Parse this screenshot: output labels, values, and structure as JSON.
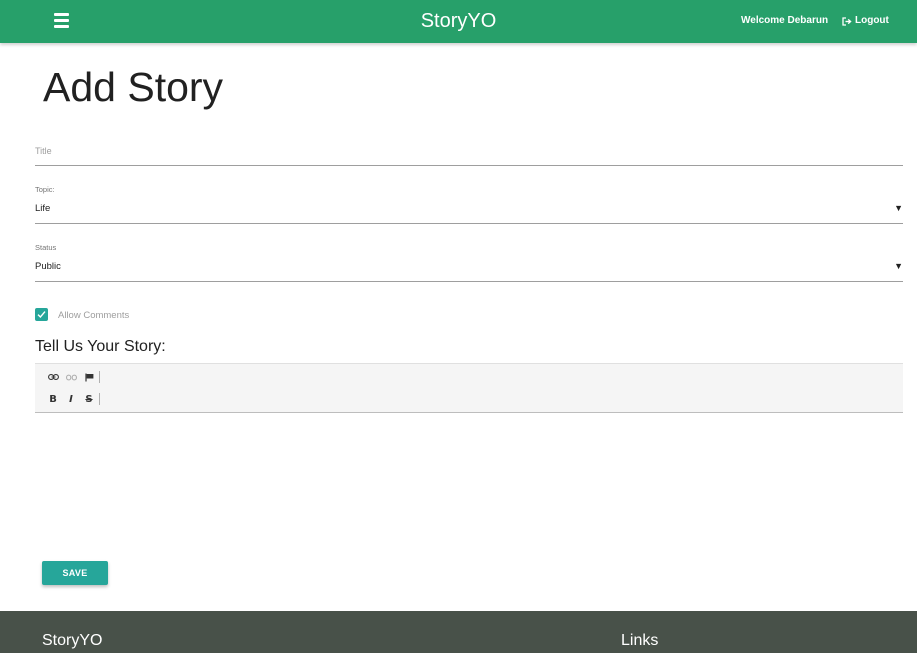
{
  "navbar": {
    "brand": "StoryYO",
    "welcome": "Welcome Debarun",
    "logout_label": "Logout",
    "menu_icon": "hamburger-menu-icon",
    "logout_icon": "sign-out-icon",
    "color": "#27a06a"
  },
  "page": {
    "title": "Add Story"
  },
  "form": {
    "title_placeholder": "Title",
    "topic": {
      "label": "Topic:",
      "value": "Life"
    },
    "status": {
      "label": "Status",
      "value": "Public"
    },
    "allow_comments": {
      "label": "Allow Comments",
      "checked": true
    },
    "story_heading": "Tell Us Your Story:",
    "editor_toolbar": {
      "row1": [
        "link-icon",
        "unlink-icon",
        "anchor-flag-icon"
      ],
      "row2": [
        "bold",
        "italic",
        "strikethrough"
      ],
      "bold_label": "B",
      "italic_label": "I",
      "strike_label": "S"
    },
    "save_label": "SAVE",
    "accent": "#26a69a"
  },
  "footer": {
    "brand": "StoryYO",
    "links_heading": "Links",
    "color": "#485149"
  }
}
